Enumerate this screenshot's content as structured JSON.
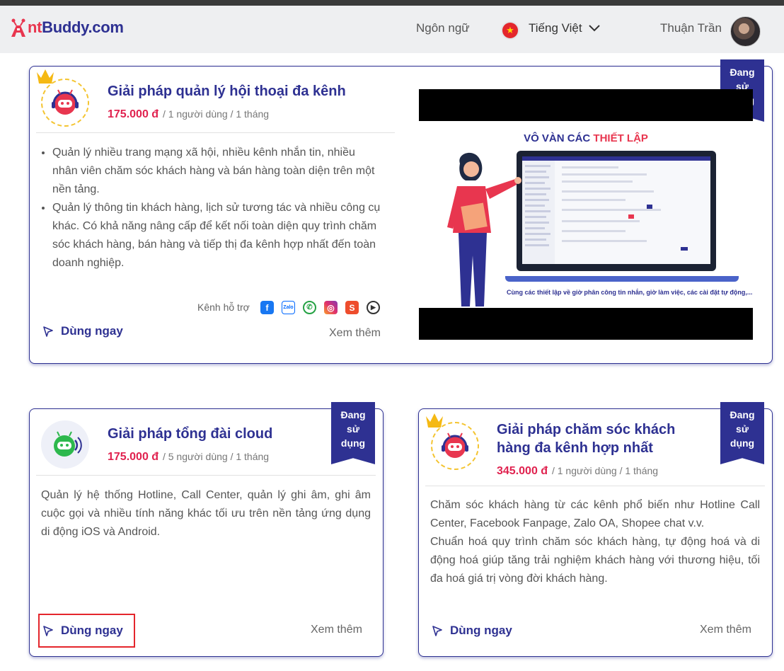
{
  "header": {
    "logo_prefix": "nt",
    "logo_text": "Buddy.com",
    "language_label": "Ngôn ngữ",
    "language_selected": "Tiếng Việt",
    "user_name": "Thuận Trần"
  },
  "cards": [
    {
      "title": "Giải pháp quản lý hội thoại đa kênh",
      "price": "175.000 đ",
      "price_unit": "/ 1 người dùng / 1 tháng",
      "badge": [
        "Đang",
        "sử",
        "dụng"
      ],
      "bullets": [
        "Quản lý nhiều trang mạng xã hội, nhiều kênh nhắn tin, nhiều nhân viên chăm sóc khách hàng và bán hàng toàn diện trên một nền tảng.",
        "Quản lý thông tin khách hàng, lịch sử tương tác và nhiều công cụ khác. Có khả năng nâng cấp để kết nối toàn diện quy trình chăm sóc khách hàng, bán hàng và tiếp thị đa kênh hợp nhất đến toàn doanh nghiệp."
      ],
      "channels_label": "Kênh hỗ trợ",
      "channels": [
        "facebook-icon",
        "zalo-icon",
        "whatsapp-icon",
        "instagram-icon",
        "shopee-icon",
        "play-icon"
      ],
      "use_label": "Dùng ngay",
      "more_label": "Xem thêm",
      "promo": {
        "title_prefix": "VÔ VÀN CÁC ",
        "title_highlight": "THIẾT LẬP",
        "caption": "Cùng các thiết lập về giờ phân công tin nhắn, giờ làm việc, các cài đặt tự động,..."
      }
    },
    {
      "title": "Giải pháp tổng đài cloud",
      "price": "175.000 đ",
      "price_unit": "/ 5 người dùng / 1 tháng",
      "badge": [
        "Đang",
        "sử",
        "dụng"
      ],
      "description": "Quản lý hệ thống Hotline, Call Center, quản lý ghi âm, ghi âm cuộc gọi và nhiều tính năng khác tối ưu trên nền tảng ứng dụng di động iOS và Android.",
      "use_label": "Dùng ngay",
      "more_label": "Xem thêm"
    },
    {
      "title_line1": "Giải pháp chăm sóc khách",
      "title_line2": "hàng đa kênh hợp nhất",
      "price": "345.000 đ",
      "price_unit": "/ 1 người dùng / 1 tháng",
      "badge": [
        "Đang",
        "sử",
        "dụng"
      ],
      "description_line1": "Chăm sóc khách hàng từ các kênh phổ biến như Hotline Call Center, Facebook Fanpage, Zalo OA, Shopee chat v.v.",
      "description_line2": "Chuẩn hoá quy trình chăm sóc khách hàng, tự động hoá và di động hoá giúp tăng trải nghiệm khách hàng với thương hiệu, tối đa hoá giá trị vòng đời khách hàng.",
      "use_label": "Dùng ngay",
      "more_label": "Xem thêm"
    }
  ],
  "colors": {
    "brand": "#2e3192",
    "accent": "#e8364f",
    "price": "#e0224f",
    "highlight_box": "#e4262c"
  }
}
